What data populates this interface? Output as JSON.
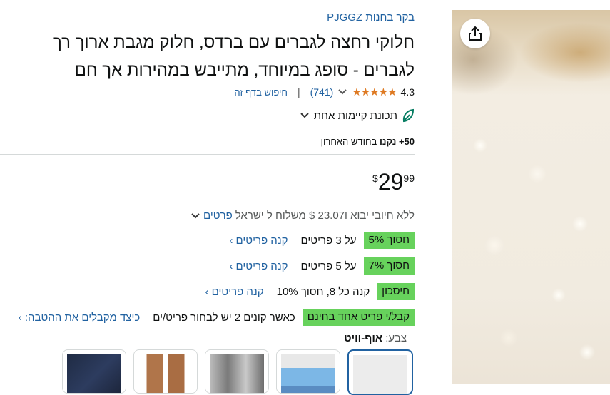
{
  "store": {
    "link_text": "בקר בחנות PJGGZ"
  },
  "product": {
    "title": "חלוקי רחצה לגברים עם ברדס, חלוק מגבת ארוך רך לגברים - סופג במיוחד, מתייבש במהירות אך חם",
    "rating": "4.3",
    "stars": "★★★★★",
    "reviews": "(741)",
    "search_page": "חיפוש בדף זה",
    "sustainability": "תכונת קיימות אחת",
    "bought_count": "50+",
    "bought_word": "נקנו",
    "bought_suffix": "בחודש האחרון"
  },
  "price": {
    "currency": "$",
    "whole": "29",
    "fraction": "99"
  },
  "shipping": {
    "text": "ללא חיובי יבוא ו‎$ 23.07‎ משלוח ל ישראל",
    "details_link": "פרטים"
  },
  "promotions": [
    {
      "badge": "חסוך 5%",
      "text": "על 3 פריטים",
      "link": "קנה פריטים ›"
    },
    {
      "badge": "חסוך 7%",
      "text": "על 5 פריטים",
      "link": "קנה פריטים ›"
    },
    {
      "badge": "חיסכון",
      "text": "קנה כל 8, חסוך 10%",
      "link": "קנה פריטים ›"
    },
    {
      "badge": "קבל/י פריט אחד בחינם",
      "text": "כאשר קונים 2 יש לבחור פריט/ים",
      "link": "כיצד מקבלים את ההטבה: ›"
    }
  ],
  "color": {
    "label": "צבע:",
    "value": "אוף-וויט"
  },
  "icons": {
    "share": "share-icon",
    "chevron": "chevron-down-icon",
    "leaf": "leaf-icon",
    "star": "star-icon"
  },
  "colors": {
    "link": "#2162a1",
    "badge": "#67d25c",
    "star": "#de7921",
    "sustain": "#067d62"
  }
}
